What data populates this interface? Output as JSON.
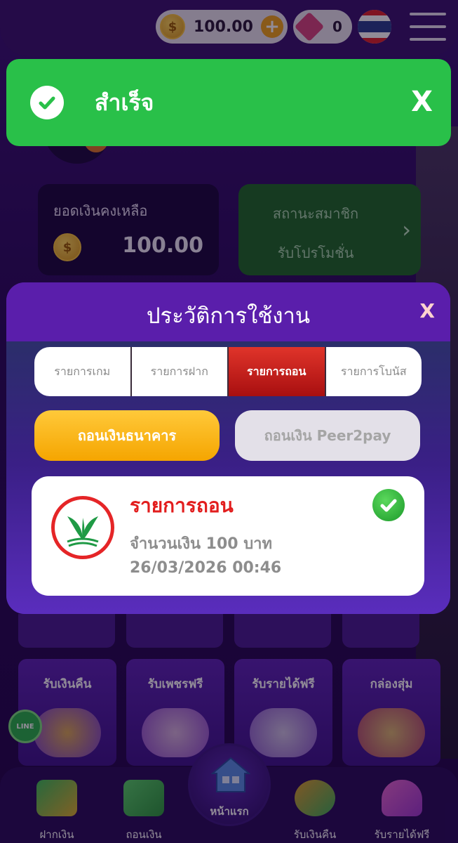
{
  "header": {
    "coin_symbol": "$",
    "coin_balance": "100.00",
    "plus_symbol": "+",
    "gem_count": "0"
  },
  "toast": {
    "message": "สำเร็จ",
    "close": "X"
  },
  "balance": {
    "label": "ยอดเงินคงเหลือ",
    "amount": "100.00"
  },
  "member": {
    "title": "สถานะสมาชิก",
    "subtitle": "รับโปรโมชั่น",
    "arrow": "›"
  },
  "modal": {
    "title": "ประวัติการใช้งาน",
    "close": "X",
    "tabs": [
      {
        "label": "รายการเกม"
      },
      {
        "label": "รายการฝาก"
      },
      {
        "label": "รายการถอน"
      },
      {
        "label": "รายการโบนัส"
      }
    ],
    "active_tab": "รายการถอน",
    "withdraw_bank": "ถอนเงินธนาคาร",
    "withdraw_p2p": "ถอนเงิน Peer2pay",
    "transaction": {
      "title": "รายการถอน",
      "amount": "จำนวนเงิน 100 บาท",
      "datetime": "26/03/2026  00:46"
    }
  },
  "tiles": [
    {
      "label": "รับเงินคืน"
    },
    {
      "label": "รับเพชรฟรี"
    },
    {
      "label": "รับรายได้ฟรี"
    },
    {
      "label": "กล่องสุ่ม"
    }
  ],
  "line_label": "LINE",
  "bottom_nav": {
    "deposit": "ฝากเงิน",
    "withdraw": "ถอนเงิน",
    "home": "หน้าแรก",
    "cashback": "รับเงินคืน",
    "free_income": "รับรายได้ฟรี"
  },
  "colors": {
    "success": "#29c049",
    "active_tab": "#c8201c",
    "bank_button": "#ffb81c",
    "transaction_title": "#e21d1d"
  }
}
